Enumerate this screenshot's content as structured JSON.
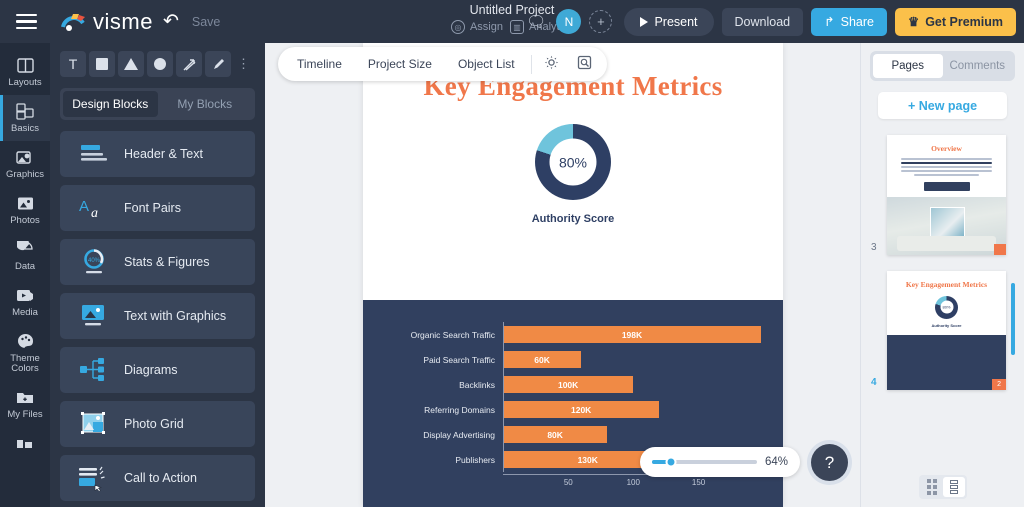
{
  "header": {
    "menu_icon": "hamburger-icon",
    "brand": "visme",
    "undo_icon": "undo-icon",
    "save_label": "Save",
    "project_title": "Untitled Project",
    "assign_label": "Assign",
    "analytics_label": "Analytics",
    "chat_icon": "comment-icon",
    "avatar_initial": "N",
    "add_user_icon": "add-person-icon",
    "present_label": "Present",
    "download_label": "Download",
    "share_label": "Share",
    "premium_label": "Get Premium"
  },
  "rail": {
    "items": [
      {
        "label": "Layouts",
        "icon": "layouts-icon",
        "active": false
      },
      {
        "label": "Basics",
        "icon": "basics-icon",
        "active": true
      },
      {
        "label": "Graphics",
        "icon": "graphics-icon",
        "active": false
      },
      {
        "label": "Photos",
        "icon": "photos-icon",
        "active": false
      },
      {
        "label": "Data",
        "icon": "data-pie-icon",
        "active": false
      },
      {
        "label": "Media",
        "icon": "media-play-icon",
        "active": false
      },
      {
        "label": "Theme Colors",
        "icon": "palette-icon",
        "active": false
      },
      {
        "label": "My Files",
        "icon": "folder-icon",
        "active": false
      }
    ]
  },
  "panel": {
    "tools": [
      {
        "name": "text-tool",
        "glyph": "T"
      },
      {
        "name": "square-tool",
        "glyph": ""
      },
      {
        "name": "triangle-tool",
        "glyph": ""
      },
      {
        "name": "circle-tool",
        "glyph": ""
      },
      {
        "name": "line-tool",
        "glyph": "⤢"
      },
      {
        "name": "pen-tool",
        "glyph": "✎"
      }
    ],
    "more_label": "⋮",
    "tabs": [
      {
        "label": "Design Blocks",
        "active": true
      },
      {
        "label": "My Blocks",
        "active": false
      }
    ],
    "blocks": [
      {
        "label": "Header & Text",
        "icon": "header-text-icon"
      },
      {
        "label": "Font Pairs",
        "icon": "font-pairs-icon"
      },
      {
        "label": "Stats & Figures",
        "icon": "stats-figures-icon"
      },
      {
        "label": "Text with Graphics",
        "icon": "text-with-graphics-icon"
      },
      {
        "label": "Diagrams",
        "icon": "diagrams-icon"
      },
      {
        "label": "Photo Grid",
        "icon": "photo-grid-icon"
      },
      {
        "label": "Call to Action",
        "icon": "call-to-action-icon"
      }
    ]
  },
  "canvas_toolbar": {
    "items": [
      "Timeline",
      "Project Size",
      "Object List"
    ],
    "gear_icon": "gear-icon",
    "zoom_icon": "zoom-search-icon"
  },
  "slide": {
    "title": "Key Engagement Metrics",
    "title_color": "#f0774a",
    "donut": {
      "value_label": "80%",
      "caption": "Authority Score",
      "filled_color": "#2e3f64",
      "remainder_color": "#6fc4dc"
    }
  },
  "chart_data": {
    "type": "bar",
    "orientation": "horizontal",
    "title": "",
    "categories": [
      "Organic Search Traffic",
      "Paid Search Traffic",
      "Backlinks",
      "Referring Domains",
      "Display Advertising",
      "Publishers"
    ],
    "values": [
      198,
      60,
      100,
      120,
      80,
      130
    ],
    "value_labels": [
      "198K",
      "60K",
      "100K",
      "120K",
      "80K",
      "130K"
    ],
    "xlabel": "",
    "ylabel": "",
    "xlim": [
      0,
      198
    ],
    "xticks": [
      50,
      100,
      150
    ],
    "xtick_labels": [
      "50",
      "100",
      "150"
    ],
    "grid": false,
    "legend": "none",
    "bar_color": "#f08a45",
    "background_color": "#31405f",
    "label_color": "#e7ebf2"
  },
  "zoom_control": {
    "value_label": "64%",
    "percent": 18
  },
  "help": {
    "label": "?"
  },
  "pages_panel": {
    "tabs": [
      {
        "label": "Pages",
        "active": true
      },
      {
        "label": "Comments",
        "active": false
      }
    ],
    "new_page_label": "+ New page",
    "thumbnails": [
      {
        "number": "3",
        "title": "Overview",
        "badge": "",
        "selected": false,
        "type": "overview"
      },
      {
        "number": "4",
        "title": "Key Engagement Metrics",
        "donut_label": "80%",
        "donut_caption": "Authority Score",
        "badge": "2",
        "selected": true,
        "type": "metrics"
      }
    ],
    "view_modes": [
      {
        "name": "grid-view",
        "active": false
      },
      {
        "name": "list-view",
        "active": true
      }
    ]
  }
}
